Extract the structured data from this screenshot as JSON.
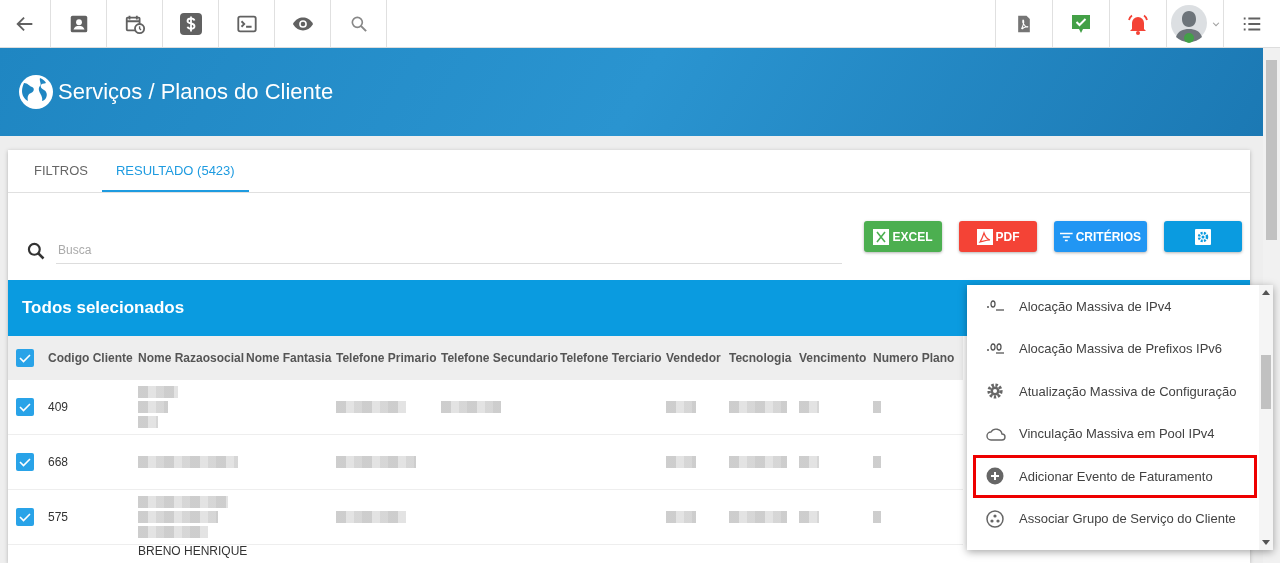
{
  "page_title": "Serviços / Planos do Cliente",
  "tabs": [
    {
      "label": "FILTROS",
      "selected": false
    },
    {
      "label": "RESULTADO (5423)",
      "selected": true
    }
  ],
  "search": {
    "placeholder": "Busca"
  },
  "action_buttons": [
    {
      "kind": "excel",
      "label": "EXCEL"
    },
    {
      "kind": "pdf",
      "label": "PDF"
    },
    {
      "kind": "criteria",
      "label": "CRITÉRIOS"
    },
    {
      "kind": "settings"
    }
  ],
  "selection_bar": {
    "title": "Todos selecionados"
  },
  "table": {
    "select_all": {
      "checked": true
    },
    "columns": [
      "Codigo Cliente",
      "Nome Razaosocial",
      "Nome Fantasia",
      "Telefone Primario",
      "Telefone Secundario",
      "Telefone Terciario",
      "Vendedor",
      "Tecnologia",
      "Vencimento",
      "Numero Plano"
    ],
    "rows": [
      {
        "checked": true,
        "codigo_cliente": "409"
      },
      {
        "checked": true,
        "codigo_cliente": "668"
      },
      {
        "checked": true,
        "codigo_cliente": "575"
      },
      {
        "nome_razaosocial": "BRENO HENRIQUE"
      }
    ]
  },
  "action_menu": {
    "items": [
      {
        "kind": "ipv4",
        "label": "Alocação Massiva de IPv4",
        "highlighted": false
      },
      {
        "kind": "ipv6",
        "label": "Alocação Massiva de Prefixos IPv6",
        "highlighted": false
      },
      {
        "kind": "gear",
        "label": "Atualização Massiva de Configuração",
        "highlighted": false
      },
      {
        "kind": "cloud",
        "label": "Vinculação Massiva em Pool IPv4",
        "highlighted": false
      },
      {
        "kind": "plus",
        "label": "Adicionar Evento de Faturamento",
        "highlighted": true
      },
      {
        "kind": "group",
        "label": "Associar Grupo de Serviço do Cliente",
        "highlighted": false
      }
    ]
  }
}
